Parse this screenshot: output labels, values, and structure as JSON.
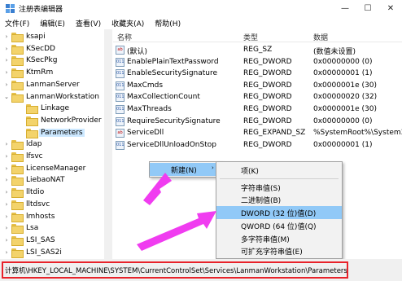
{
  "window": {
    "title": "注册表编辑器",
    "minimize": "—",
    "maximize": "☐",
    "close": "✕"
  },
  "menubar": [
    "文件(F)",
    "编辑(E)",
    "查看(V)",
    "收藏夹(A)",
    "帮助(H)"
  ],
  "tree": {
    "items": [
      {
        "label": "ksapi",
        "level": 0,
        "expander": "›"
      },
      {
        "label": "KSecDD",
        "level": 0,
        "expander": "›"
      },
      {
        "label": "KSecPkg",
        "level": 0,
        "expander": "›"
      },
      {
        "label": "KtmRm",
        "level": 0,
        "expander": "›"
      },
      {
        "label": "LanmanServer",
        "level": 0,
        "expander": "›"
      },
      {
        "label": "LanmanWorkstation",
        "level": 0,
        "expander": "⌄"
      },
      {
        "label": "Linkage",
        "level": 1,
        "expander": ""
      },
      {
        "label": "NetworkProvider",
        "level": 1,
        "expander": ""
      },
      {
        "label": "Parameters",
        "level": 1,
        "expander": "",
        "selected": true
      },
      {
        "label": "ldap",
        "level": 0,
        "expander": "›"
      },
      {
        "label": "lfsvc",
        "level": 0,
        "expander": "›"
      },
      {
        "label": "LicenseManager",
        "level": 0,
        "expander": "›"
      },
      {
        "label": "LiebaoNAT",
        "level": 0,
        "expander": "›"
      },
      {
        "label": "lltdio",
        "level": 0,
        "expander": "›"
      },
      {
        "label": "lltdsvc",
        "level": 0,
        "expander": "›"
      },
      {
        "label": "lmhosts",
        "level": 0,
        "expander": "›"
      },
      {
        "label": "Lsa",
        "level": 0,
        "expander": "›"
      },
      {
        "label": "LSI_SAS",
        "level": 0,
        "expander": "›"
      },
      {
        "label": "LSI_SAS2i",
        "level": 0,
        "expander": "›"
      },
      {
        "label": "LSI_SAS3i",
        "level": 0,
        "expander": "›"
      }
    ]
  },
  "list": {
    "headers": {
      "name": "名称",
      "type": "类型",
      "data": "数据"
    },
    "rows": [
      {
        "name": "(默认)",
        "type": "REG_SZ",
        "data": "(数值未设置)",
        "icon": "ab"
      },
      {
        "name": "EnablePlainTextPassword",
        "type": "REG_DWORD",
        "data": "0x00000000 (0)",
        "icon": "011"
      },
      {
        "name": "EnableSecuritySignature",
        "type": "REG_DWORD",
        "data": "0x00000001 (1)",
        "icon": "011"
      },
      {
        "name": "MaxCmds",
        "type": "REG_DWORD",
        "data": "0x0000001e (30)",
        "icon": "011"
      },
      {
        "name": "MaxCollectionCount",
        "type": "REG_DWORD",
        "data": "0x00000020 (32)",
        "icon": "011"
      },
      {
        "name": "MaxThreads",
        "type": "REG_DWORD",
        "data": "0x0000001e (30)",
        "icon": "011"
      },
      {
        "name": "RequireSecuritySignature",
        "type": "REG_DWORD",
        "data": "0x00000000 (0)",
        "icon": "011"
      },
      {
        "name": "ServiceDll",
        "type": "REG_EXPAND_SZ",
        "data": "%SystemRoot%\\System32\\",
        "icon": "ab"
      },
      {
        "name": "ServiceDllUnloadOnStop",
        "type": "REG_DWORD",
        "data": "0x00000001 (1)",
        "icon": "011"
      }
    ]
  },
  "context_menu": {
    "new_label": "新建(N)",
    "arrow": "›"
  },
  "submenu": {
    "items": [
      {
        "label": "项(K)"
      },
      {
        "label": "字符串值(S)"
      },
      {
        "label": "二进制值(B)"
      },
      {
        "label": "DWORD (32 位)值(D)",
        "highlighted": true
      },
      {
        "label": "QWORD (64 位)值(Q)"
      },
      {
        "label": "多字符串值(M)"
      },
      {
        "label": "可扩充字符串值(E)"
      }
    ]
  },
  "statusbar": {
    "path": "计算机\\HKEY_LOCAL_MACHINE\\SYSTEM\\CurrentControlSet\\Services\\LanmanWorkstation\\Parameters"
  },
  "colors": {
    "selection": "#cce8ff",
    "highlight": "#91c9f7",
    "annotation_arrow": "#f03cf0",
    "annotation_box": "#e8222a"
  }
}
